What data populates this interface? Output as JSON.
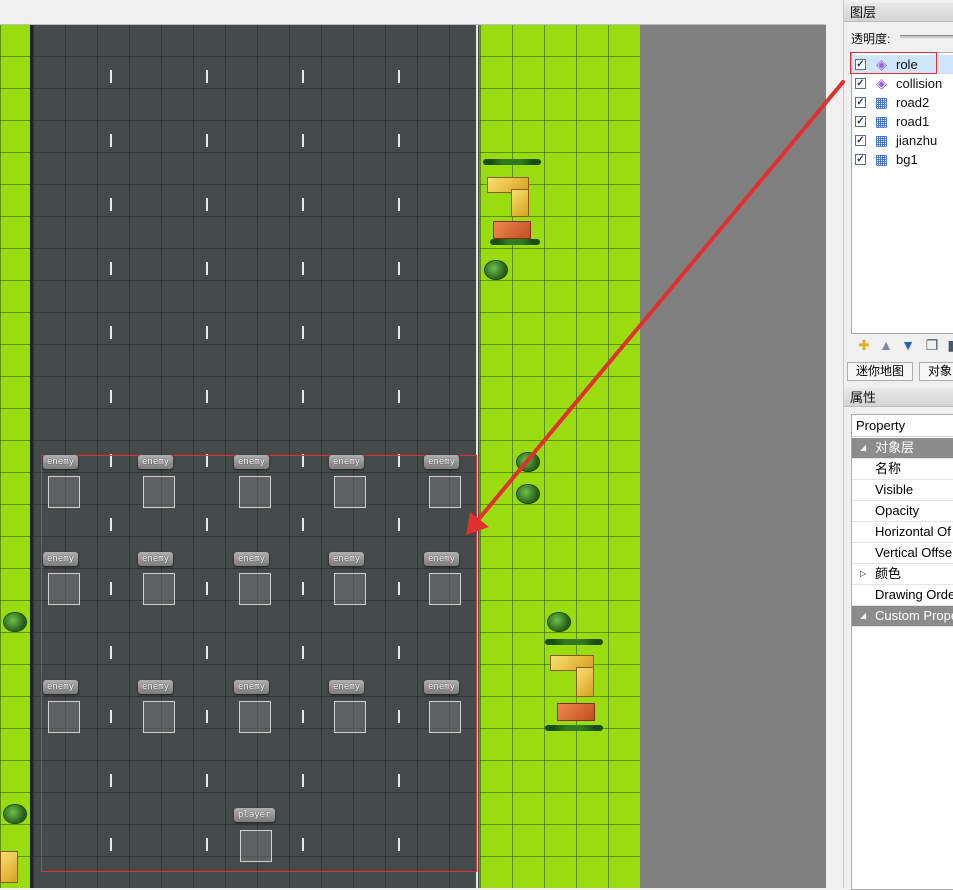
{
  "map": {
    "enemy_label": "enemy",
    "player_label": "player"
  },
  "panel": {
    "layers_title": "图层",
    "opacity_label": "透明度:",
    "layers": [
      {
        "name": "role",
        "type": "object",
        "checked": true,
        "selected": true
      },
      {
        "name": "collision",
        "type": "object",
        "checked": true,
        "selected": false
      },
      {
        "name": "road2",
        "type": "tile",
        "checked": true,
        "selected": false
      },
      {
        "name": "road1",
        "type": "tile",
        "checked": true,
        "selected": false
      },
      {
        "name": "jianzhu",
        "type": "tile",
        "checked": true,
        "selected": false
      },
      {
        "name": "bg1",
        "type": "tile",
        "checked": true,
        "selected": false
      }
    ],
    "tabs": [
      "迷你地图",
      "对象"
    ],
    "properties_title": "属性",
    "property_header": "Property",
    "properties": [
      {
        "label": "对象层",
        "group": true,
        "expanded": true
      },
      {
        "label": "名称",
        "group": false
      },
      {
        "label": "Visible",
        "group": false
      },
      {
        "label": "Opacity",
        "group": false
      },
      {
        "label": "Horizontal Of",
        "group": false
      },
      {
        "label": "Vertical Offse",
        "group": false
      },
      {
        "label": "颜色",
        "group": false,
        "collapsed": true
      },
      {
        "label": "Drawing Orde",
        "group": false
      },
      {
        "label": "Custom Prope",
        "group": true,
        "expanded": true
      }
    ]
  },
  "colors": {
    "grass": "#99dd11",
    "road": "#454a4a",
    "annotation": "#e03030",
    "selection": "#cfe5fb"
  },
  "icons": {
    "object_layer": "object-layer-icon",
    "tile_layer": "tile-layer-icon",
    "new_layer": "new-layer-icon",
    "move_up": "arrow-up-icon",
    "move_down": "arrow-down-icon",
    "duplicate": "duplicate-layer-icon"
  }
}
